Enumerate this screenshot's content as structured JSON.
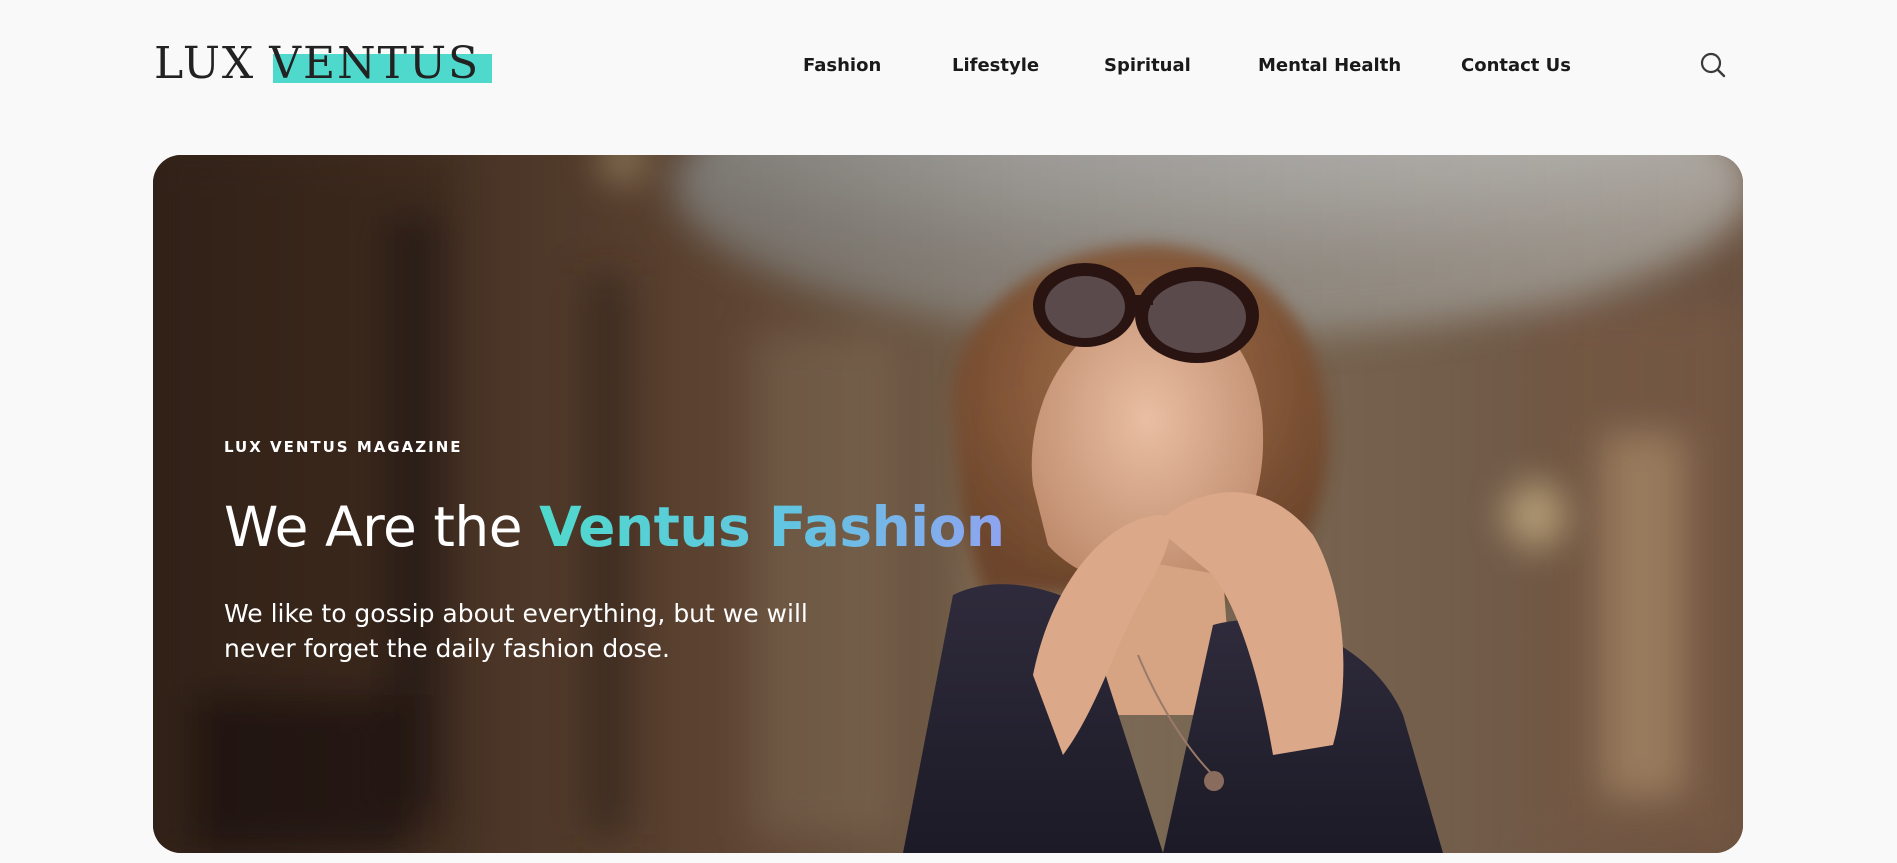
{
  "brand": {
    "logo_part1": "LUX",
    "logo_part2": "VENTUS",
    "accent_color": "#4fd9cc"
  },
  "nav": {
    "items": [
      {
        "label": "Fashion"
      },
      {
        "label": "Lifestyle"
      },
      {
        "label": "Spiritual"
      },
      {
        "label": "Mental Health"
      },
      {
        "label": "Contact Us"
      }
    ],
    "search_icon": "search-icon"
  },
  "hero": {
    "eyebrow": "LUX VENTUS MAGAZINE",
    "headline_plain": "We Are the ",
    "headline_accent": "Ventus Fashion",
    "subtext": "We like to gossip about everything, but we will never forget the daily fashion dose.",
    "gradient_colors": [
      "#4fd9cc",
      "#63c4e2",
      "#8fa3f0"
    ]
  }
}
